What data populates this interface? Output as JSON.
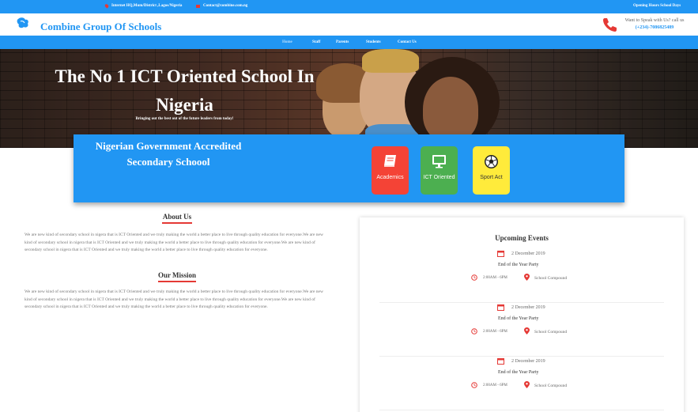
{
  "topbar": {
    "address": "Internet HQ,Mum/District ,Lagos/Nigeria",
    "contact": "Contact@combine.com.ng",
    "hours": "Opening Hours School Days"
  },
  "header": {
    "brand": "Combine Group Of Schools",
    "call_text": "Want to Speak with Us? call us",
    "phone": "(+234)-7086825489"
  },
  "nav": {
    "items": [
      "Home",
      "Staff",
      "Parents",
      "Students",
      "Contact Us"
    ]
  },
  "hero": {
    "title": "The No 1 ICT Oriented School In Nigeria",
    "subtitle": "Bringing out the best out of the future leaders from today!"
  },
  "panel": {
    "title": "Nigerian Government Accredited Secondary Schoool",
    "tiles": [
      {
        "label": "Academics",
        "icon": "book-icon",
        "color": "#f44336"
      },
      {
        "label": "ICT Oriented",
        "icon": "monitor-icon",
        "color": "#4caf50"
      },
      {
        "label": "Sport Act",
        "icon": "soccer-ball-icon",
        "color": "#ffeb3b"
      }
    ]
  },
  "about": {
    "title": "About Us",
    "text": "We are new kind of secondary school in nigera that is ICT Oriented and we truly making the world a better place to live through quality education for everyone.We are new kind of secondary school in nigera that is ICT Oriented and we truly making the world a better place to live through quality education for everyone.We are new kind of secondary school in nigera that is ICT Oriented and we truly making the world a better place to live through quality education for everyone."
  },
  "mission": {
    "title": "Our Mission",
    "text": "We are new kind of secondary school in nigera that is ICT Oriented and we truly making the world a better place to live through quality education for everyone.We are new kind of secondary school in nigera that is ICT Oriented and we truly making the world a better place to live through quality education for everyone.We are new kind of secondary school in nigera that is ICT Oriented and we truly making the world a better place to live through quality education for everyone."
  },
  "events": {
    "title": "Upcoming Events",
    "items": [
      {
        "date": "2 December 2019",
        "name": "End of the Year Party",
        "time": "2:00AM - 6PM",
        "location": "School Compound"
      },
      {
        "date": "2 December 2019",
        "name": "End of the Year Party",
        "time": "2:00AM - 6PM",
        "location": "School Compound"
      },
      {
        "date": "2 December 2019",
        "name": "End of the Year Party",
        "time": "2:00AM - 6PM",
        "location": "School Compound"
      }
    ]
  },
  "colors": {
    "primary": "#2196f3",
    "accent_red": "#e53935"
  }
}
